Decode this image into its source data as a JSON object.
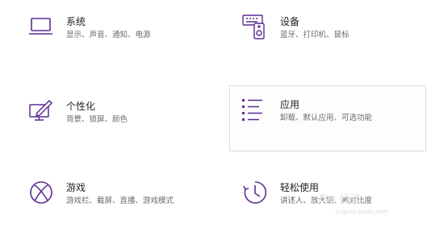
{
  "accent_color": "#5c2d91",
  "categories": [
    {
      "title": "系统",
      "description": "显示、声音、通知、电源",
      "icon": "laptop-icon"
    },
    {
      "title": "设备",
      "description": "蓝牙、打印机、鼠标",
      "icon": "devices-icon"
    },
    {
      "title": "个性化",
      "description": "背景、锁屏、颜色",
      "icon": "personalization-icon"
    },
    {
      "title": "应用",
      "description": "卸载、默认应用、可选功能",
      "icon": "apps-list-icon",
      "hovered": true
    },
    {
      "title": "游戏",
      "description": "游戏栏、截屏、直播、游戏模式",
      "icon": "xbox-icon"
    },
    {
      "title": "轻松使用",
      "description": "讲述人、放大镜、高对比度",
      "icon": "ease-of-access-icon"
    }
  ],
  "watermark": {
    "text": "Bai 经验",
    "sub": "jingyan.baidu.com"
  }
}
